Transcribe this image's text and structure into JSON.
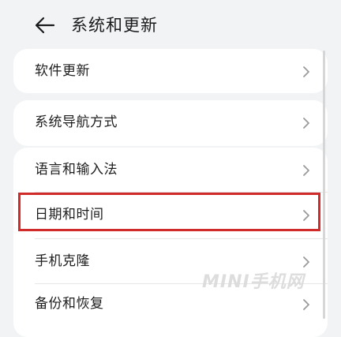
{
  "header": {
    "back_icon": "arrow-left-icon",
    "title": "系统和更新"
  },
  "groups": [
    {
      "items": [
        {
          "label": "软件更新",
          "icon": "chevron-right-icon"
        }
      ]
    },
    {
      "items": [
        {
          "label": "系统导航方式",
          "icon": "chevron-right-icon"
        }
      ]
    },
    {
      "items": [
        {
          "label": "语言和输入法",
          "icon": "chevron-right-icon"
        },
        {
          "label": "日期和时间",
          "icon": "chevron-right-icon",
          "highlighted": true
        },
        {
          "label": "手机克隆",
          "icon": "chevron-right-icon"
        },
        {
          "label": "备份和恢复",
          "icon": "chevron-right-icon"
        }
      ]
    }
  ],
  "watermark": "MINI手机网",
  "colors": {
    "background": "#f1f3f5",
    "card": "#ffffff",
    "highlight_border": "#d12a2a",
    "text": "#1e1e1e",
    "chevron": "#9a9a9a"
  }
}
